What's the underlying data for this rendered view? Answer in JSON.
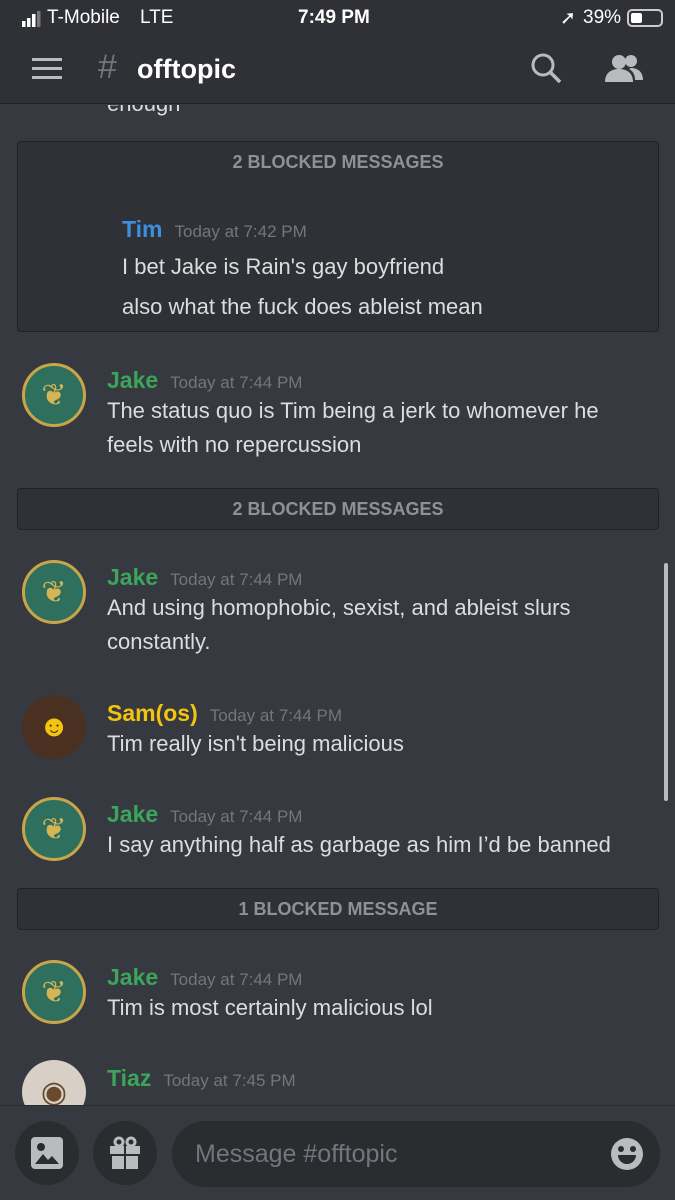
{
  "status": {
    "carrier": "T-Mobile",
    "network": "LTE",
    "time": "7:49 PM",
    "battery": "39%"
  },
  "header": {
    "hash": "#",
    "channel": "offtopic"
  },
  "chat": {
    "partial_top": "enough",
    "blocked1": {
      "label": "2 BLOCKED MESSAGES",
      "name": "Tim",
      "time": "Today at 7:42 PM",
      "lines": [
        "I bet Jake is Rain's gay boyfriend",
        "also what the fuck does ableist mean"
      ]
    },
    "m1": {
      "name": "Jake",
      "time": "Today at 7:44 PM",
      "lines": [
        "The status quo is Tim being a jerk to whomever he",
        "feels with no repercussion"
      ]
    },
    "blocked2": {
      "label": "2 BLOCKED MESSAGES"
    },
    "m2": {
      "name": "Jake",
      "time": "Today at 7:44 PM",
      "lines": [
        "And using homophobic, sexist, and ableist slurs",
        "constantly."
      ]
    },
    "m3": {
      "name": "Sam(os)",
      "time": "Today at 7:44 PM",
      "lines": [
        "Tim really isn't being malicious"
      ]
    },
    "m4": {
      "name": "Jake",
      "time": "Today at 7:44 PM",
      "lines": [
        "I say anything half as garbage as him I’d be banned"
      ]
    },
    "blocked3": {
      "label": "1 BLOCKED MESSAGE"
    },
    "m5": {
      "name": "Jake",
      "time": "Today at 7:44 PM",
      "lines": [
        "Tim is most certainly malicious lol"
      ]
    },
    "m6": {
      "name": "Tiaz",
      "time": "Today at 7:45 PM"
    }
  },
  "input": {
    "placeholder": "Message #offtopic"
  },
  "colors": {
    "tim": "#3b8fe0",
    "jake": "#3ba55c",
    "sam": "#f1c40f",
    "tiaz": "#3ba55c"
  }
}
